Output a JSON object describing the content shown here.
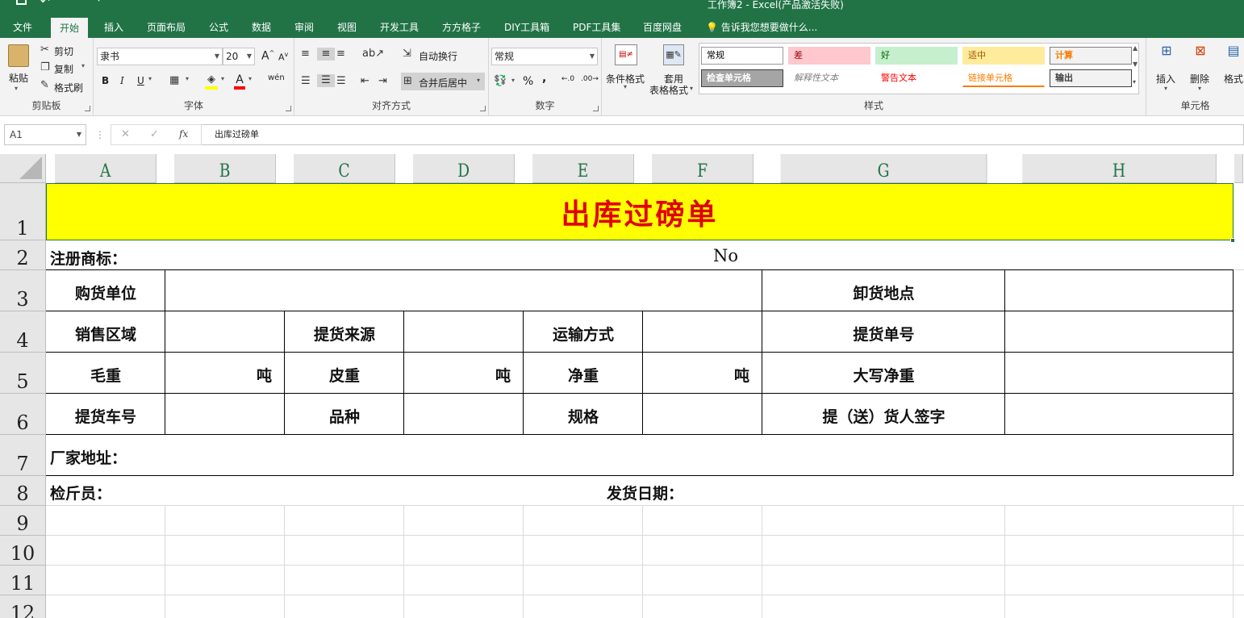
{
  "titlebar": {
    "window_title": "工作簿2 - Excel(产品激活失败)"
  },
  "tabs": [
    "文件",
    "开始",
    "插入",
    "页面布局",
    "公式",
    "数据",
    "审阅",
    "视图",
    "开发工具",
    "方方格子",
    "DIY工具箱",
    "PDF工具集",
    "百度网盘"
  ],
  "tell_me": "告诉我您想要做什么...",
  "ribbon": {
    "clipboard": {
      "paste": "粘贴",
      "cut": "剪切",
      "copy": "复制",
      "format_painter": "格式刷",
      "label": "剪贴板"
    },
    "font": {
      "name": "隶书",
      "size": "20",
      "bold": "B",
      "italic": "I",
      "underline": "U",
      "grow": "A",
      "shrink": "A",
      "font_color": "A",
      "phonetic": "wén",
      "label": "字体"
    },
    "alignment": {
      "wrap": "自动换行",
      "merge": "合并后居中",
      "label": "对齐方式"
    },
    "number": {
      "format": "常规",
      "percent": "%",
      "comma": ",",
      "label": "数字"
    },
    "styles": {
      "conditional": "条件格式",
      "table_format_1": "套用",
      "table_format_2": "表格格式",
      "gallery": [
        {
          "text": "常规",
          "bg": "#ffffff",
          "fg": "#000000",
          "border": "#9a9a9a"
        },
        {
          "text": "差",
          "bg": "#ffc7ce",
          "fg": "#9c0006",
          "border": "#ffc7ce"
        },
        {
          "text": "好",
          "bg": "#c6efce",
          "fg": "#006100",
          "border": "#c6efce"
        },
        {
          "text": "适中",
          "bg": "#ffeb9c",
          "fg": "#9c5700",
          "border": "#ffeb9c"
        },
        {
          "text": "计算",
          "bg": "#f2f2f2",
          "fg": "#fa7d00",
          "border": "#7f7f7f"
        },
        {
          "text": "检查单元格",
          "bg": "#a5a5a5",
          "fg": "#ffffff",
          "border": "#3f3f3f"
        },
        {
          "text": "解释性文本",
          "bg": "transparent",
          "fg": "#7f7f7f",
          "border": "transparent"
        },
        {
          "text": "警告文本",
          "bg": "transparent",
          "fg": "#ff0000",
          "border": "transparent"
        },
        {
          "text": "链接单元格",
          "bg": "transparent",
          "fg": "#fa7d00",
          "border": "transparent"
        },
        {
          "text": "输出",
          "bg": "#f2f2f2",
          "fg": "#3f3f3f",
          "border": "#3f3f3f"
        }
      ],
      "label": "样式"
    },
    "cells": {
      "insert": "插入",
      "delete": "删除",
      "format": "格式",
      "label": "单元格"
    }
  },
  "formula_bar": {
    "name_box": "A1",
    "cancel": "✕",
    "enter": "✓",
    "fx": "fx",
    "content": "出库过磅单"
  },
  "columns": [
    "A",
    "B",
    "C",
    "D",
    "E",
    "F",
    "G",
    "H"
  ],
  "rows": [
    "1",
    "2",
    "3",
    "4",
    "5",
    "6",
    "7",
    "8",
    "9",
    "10",
    "11",
    "12"
  ],
  "form": {
    "title": "出库过磅单",
    "trademark": "注册商标：",
    "no": "No",
    "buyer": "购货单位",
    "unload_place": "卸货地点",
    "sales_region": "销售区域",
    "pickup_source": "提货来源",
    "transport": "运输方式",
    "pickup_no": "提货单号",
    "gross": "毛重",
    "tare": "皮重",
    "net": "净重",
    "unit_gross": "吨",
    "unit_tare": "吨",
    "unit_net": "吨",
    "net_upper": "大写净重",
    "truck_no": "提货车号",
    "variety": "品种",
    "spec": "规格",
    "signature": "提（送）货人签字",
    "factory_addr": "厂家地址：",
    "inspector": "检斤员：",
    "ship_date": "发货日期："
  }
}
